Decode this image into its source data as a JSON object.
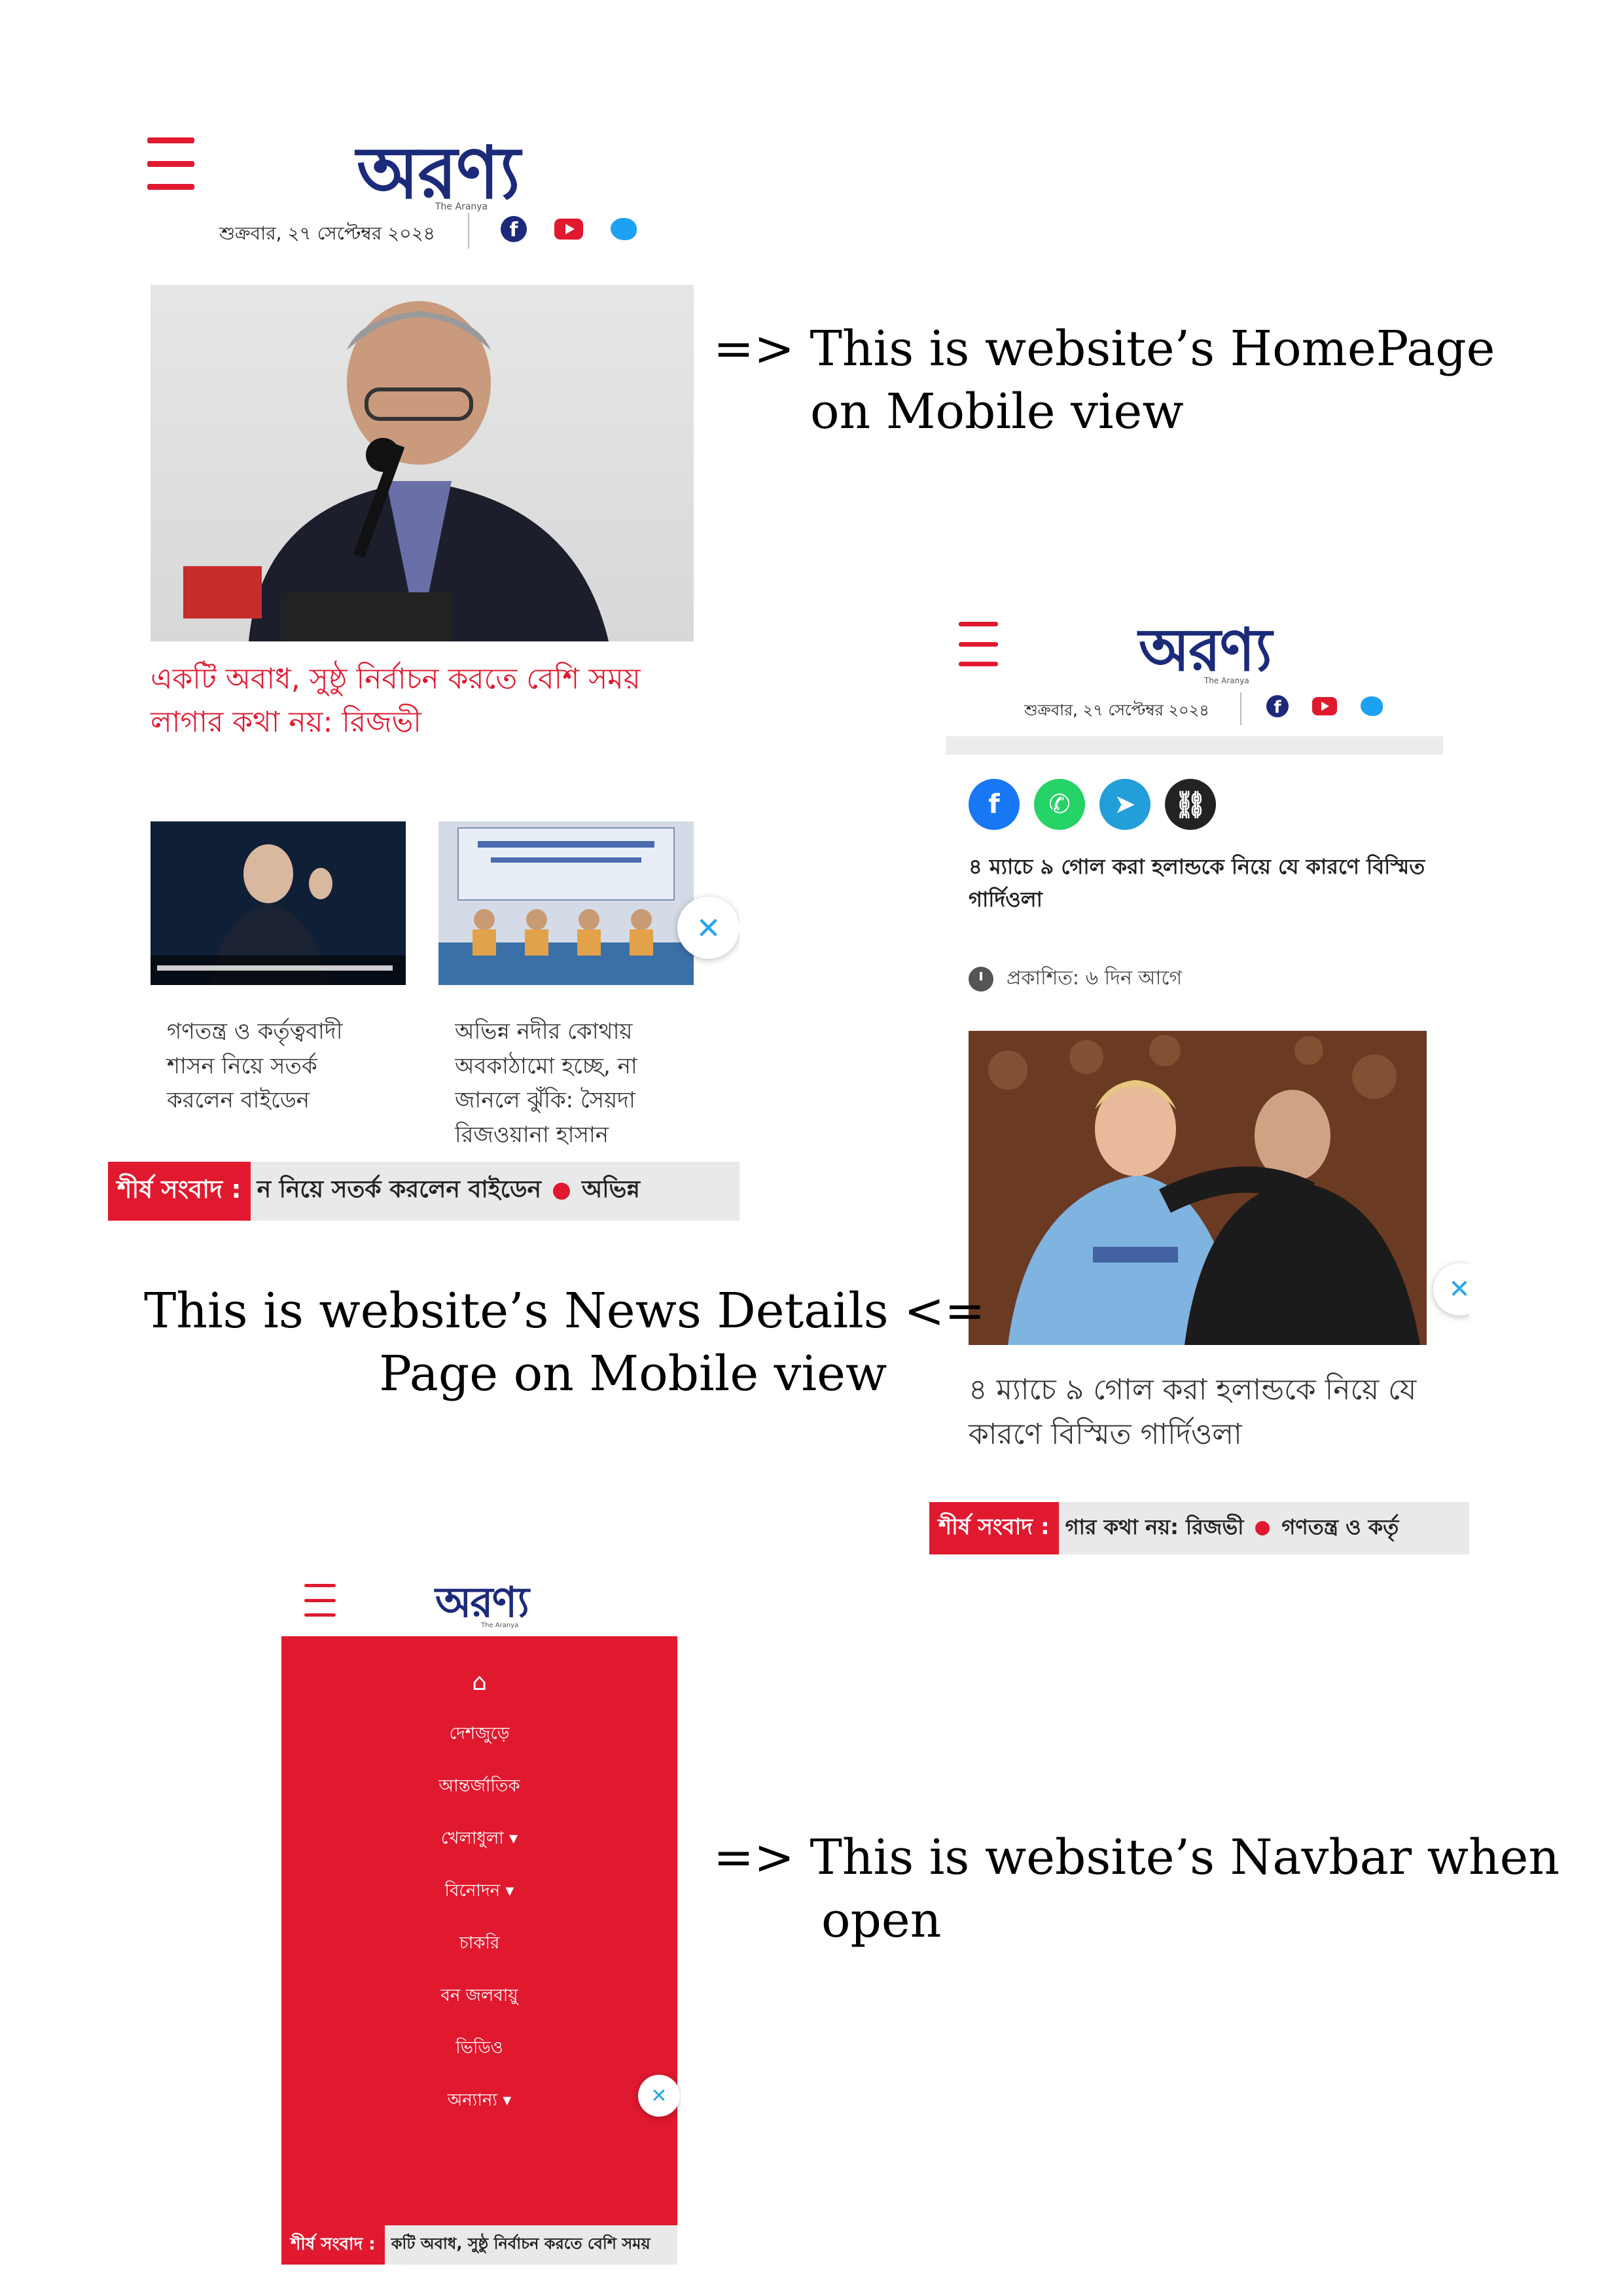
{
  "site": {
    "logo_text": "অরণ্য",
    "logo_tagline": "The Aranya"
  },
  "header": {
    "date": "শুক্রবার, ২৭ সেপ্টেম্বর ২০২৪",
    "menu_icon": "hamburger-icon",
    "social_icons": [
      "facebook-icon",
      "youtube-icon",
      "twitter-icon"
    ]
  },
  "colors": {
    "brand_red": "#e0192f",
    "logo_blue": "#1c2a7a",
    "facebook": "#1877f2",
    "whatsapp": "#25d366",
    "telegram": "#229ed9",
    "link": "#222222"
  },
  "homepage": {
    "lead_headline": "একটি অবাধ, সুষ্ঠু নির্বাচন করতে বেশি সময় লাগার কথা নয়: রিজভী",
    "cards": [
      {
        "title": "গণতন্ত্র ও কর্তৃত্ববাদী শাসন নিয়ে সতর্ক করলেন বাইডেন"
      },
      {
        "title": "অভিন্ন নদীর কোথায় অবকাঠামো হচ্ছে, না জানলে ঝুঁকি: সৈয়দা রিজওয়ানা হাসান"
      }
    ],
    "ticker_label": "শীর্ষ সংবাদ :",
    "ticker_text": "ন নিয়ে সতর্ক করলেন বাইডেন",
    "ticker_next": "অভিন্ন"
  },
  "details": {
    "share_icons": [
      "facebook-share-icon",
      "whatsapp-share-icon",
      "telegram-share-icon",
      "link-copy-icon"
    ],
    "title": "৪ ম্যাচে ৯ গোল করা হলান্ডকে নিয়ে যে কারণে বিস্মিত গার্দিওলা",
    "published": "প্রকাশিত: ৬ দিন আগে",
    "caption_title": "৪ ম্যাচে ৯ গোল করা হলান্ডকে নিয়ে যে কারণে বিস্মিত গার্দিওলা",
    "ticker_label": "শীর্ষ সংবাদ :",
    "ticker_text": "গার কথা নয়: রিজভী",
    "ticker_next": "গণতন্ত্র ও কর্তৃ"
  },
  "navbar": {
    "items": [
      {
        "label": "",
        "icon": "home-icon"
      },
      {
        "label": "দেশজুড়ে"
      },
      {
        "label": "আন্তর্জাতিক"
      },
      {
        "label": "খেলাধুলা ▾"
      },
      {
        "label": "বিনোদন ▾"
      },
      {
        "label": "চাকরি"
      },
      {
        "label": "বন জলবায়ু"
      },
      {
        "label": "ভিডিও"
      },
      {
        "label": "অন্যান্য ▾"
      }
    ],
    "ticker_label": "শীর্ষ সংবাদ :",
    "ticker_text": "কটি অবাধ, সুষ্ঠু নির্বাচন করতে বেশি সময় "
  },
  "captions": {
    "homepage": [
      "=>  This is website’s HomePage",
      "on Mobile view"
    ],
    "details": [
      "This is website’s News Details  <=",
      "Page on Mobile view"
    ],
    "navbar": [
      "=>  This is website’s Navbar when",
      "open"
    ]
  }
}
